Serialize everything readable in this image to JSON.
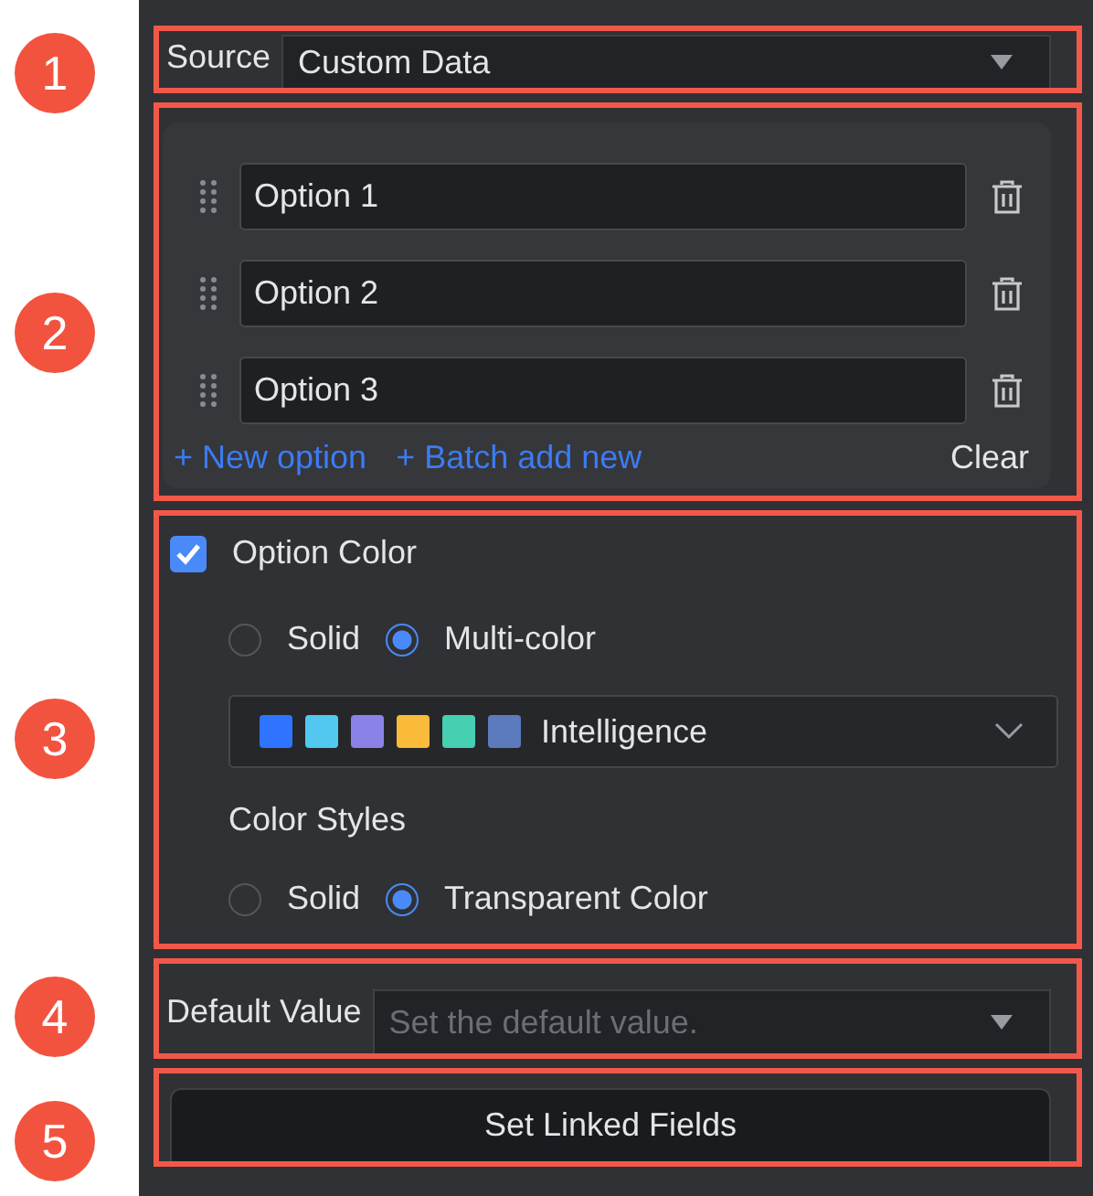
{
  "callouts": [
    "1",
    "2",
    "3",
    "4",
    "5"
  ],
  "source": {
    "label": "Source",
    "value": "Custom Data"
  },
  "options": [
    {
      "value": "Option 1"
    },
    {
      "value": "Option 2"
    },
    {
      "value": "Option 3"
    }
  ],
  "option_actions": {
    "new_option": "+ New option",
    "batch_add": "+ Batch add new",
    "clear": "Clear"
  },
  "option_color": {
    "label": "Option Color",
    "checked": true,
    "modes": [
      {
        "label": "Solid",
        "selected": false
      },
      {
        "label": "Multi-color",
        "selected": true
      }
    ],
    "palette": {
      "name": "Intelligence",
      "colors": [
        {
          "color": "#2f74ff"
        },
        {
          "color": "#52c8f0"
        },
        {
          "color": "#8b82e8"
        },
        {
          "color": "#fbbb3a"
        },
        {
          "color": "#46cfb0"
        },
        {
          "color": "#5c7bbd"
        }
      ]
    },
    "styles_label": "Color Styles",
    "styles": [
      {
        "label": "Solid",
        "selected": false
      },
      {
        "label": "Transparent Color",
        "selected": true
      }
    ]
  },
  "default_value": {
    "label": "Default Value",
    "placeholder": "Set the default value."
  },
  "linked_fields_button": "Set Linked Fields"
}
